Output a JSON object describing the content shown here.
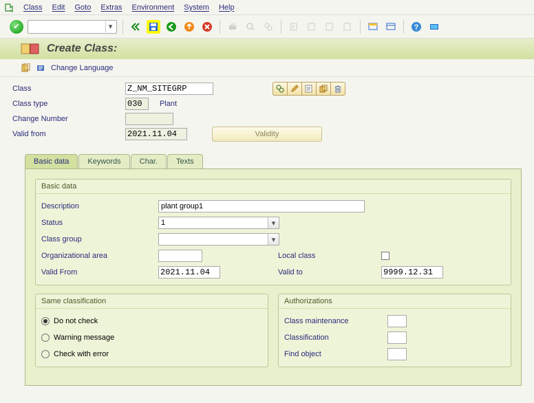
{
  "menu": [
    "Class",
    "Edit",
    "Goto",
    "Extras",
    "Environment",
    "System",
    "Help"
  ],
  "title": "Create Class:",
  "app_toolbar": {
    "change_language": "Change Language"
  },
  "header": {
    "class_label": "Class",
    "class_value": "Z_NM_SITEGRP",
    "class_type_label": "Class type",
    "class_type_code": "030",
    "class_type_text": "Plant",
    "change_number_label": "Change Number",
    "change_number_value": "",
    "valid_from_label": "Valid from",
    "valid_from_value": "2021.11.04",
    "validity_btn": "Validity"
  },
  "tabs": [
    "Basic data",
    "Keywords",
    "Char.",
    "Texts"
  ],
  "basic": {
    "group_title": "Basic data",
    "description_label": "Description",
    "description_value": "plant group1",
    "status_label": "Status",
    "status_value": "1",
    "class_group_label": "Class group",
    "class_group_value": "",
    "org_area_label": "Organizational area",
    "org_area_value": "",
    "local_class_label": "Local class",
    "valid_from_label": "Valid From",
    "valid_from_value": "2021.11.04",
    "valid_to_label": "Valid to",
    "valid_to_value": "9999.12.31"
  },
  "same_class": {
    "title": "Same classification",
    "opt1": "Do not check",
    "opt2": "Warning message",
    "opt3": "Check with error"
  },
  "auth": {
    "title": "Authorizations",
    "r1": "Class maintenance",
    "r2": "Classification",
    "r3": "Find object"
  }
}
